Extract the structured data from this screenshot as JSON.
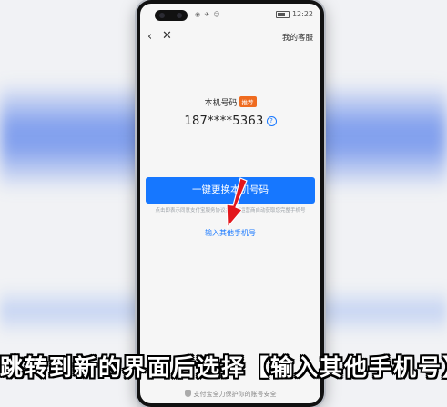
{
  "status_bar": {
    "icons": "◉ ✈ ☺",
    "time": "12:22"
  },
  "nav": {
    "back_symbol": "‹",
    "close_symbol": "✕",
    "service_label": "我的客服"
  },
  "number_section": {
    "label": "本机号码",
    "badge": "推荐",
    "phone_number": "187****5363",
    "help_symbol": "?"
  },
  "primary_button": {
    "label": "一键更换本机号码"
  },
  "agreement_text": "点击即表示同意支付宝服务协议并授权运营商自动获取您完整手机号",
  "other_link": {
    "label": "输入其他手机号"
  },
  "footer": {
    "text": "支付宝全力保护你的账号安全"
  },
  "caption": {
    "text": "跳转到新的界面后选择【输入其他手机号】"
  },
  "colors": {
    "accent": "#1677ff",
    "badge": "#ef6b1f",
    "arrow": "#e3161b"
  },
  "icons": [
    "back-icon",
    "close-icon",
    "help-icon",
    "shield-icon",
    "arrow-icon"
  ]
}
